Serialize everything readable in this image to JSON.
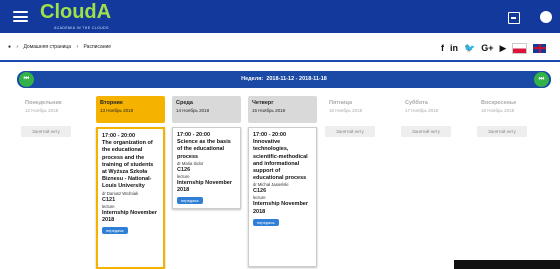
{
  "brand": {
    "name": "CloudA",
    "tagline": "ACADEMIA IN THE CLOUDS"
  },
  "breadcrumb": {
    "home": "Домашняя страница",
    "current": "Расписание"
  },
  "social": [
    "f",
    "in",
    "t",
    "G+",
    "yt"
  ],
  "week": {
    "label": "Неделя:",
    "range": "2018-11-12 - 2018-11-18"
  },
  "days": [
    {
      "name": "Понедельник",
      "date": "12 Ноябрь 2018",
      "busy": "Занятий нету"
    },
    {
      "name": "Вторник",
      "date": "13 Ноябрь 2018",
      "event": {
        "time": "17:00 - 20:00",
        "title": "The organization of the educational process and the training of students at Wyższa Szkoła Biznesu - National-Louis University",
        "teacher": "dr Dariusz Woźniak",
        "room": "C121",
        "type": "lecture",
        "course": "Internship November 2018",
        "action": "передача"
      }
    },
    {
      "name": "Среда",
      "date": "14 Ноябрь 2018",
      "event": {
        "time": "17:00 - 20:00",
        "title": "Science as the basis of the educational process",
        "teacher": "dr Maria Sidor",
        "room": "C126",
        "type": "lecture",
        "course": "Internship November 2018",
        "action": "передача"
      }
    },
    {
      "name": "Четверг",
      "date": "15 Ноябрь 2018",
      "event": {
        "time": "17:00 - 20:00",
        "title": "Innovative technologies, scientific-methodical and informational support of educational process",
        "teacher": "dr Michał Jasieński",
        "room": "C126",
        "type": "lecture",
        "course": "Internship November 2018",
        "action": "передача"
      }
    },
    {
      "name": "Пятница",
      "date": "16 Ноябрь 2018",
      "busy": "Занятий нету"
    },
    {
      "name": "Суббота",
      "date": "17 Ноябрь 2018",
      "busy": "Занятий нету"
    },
    {
      "name": "Воскресенье",
      "date": "18 Ноябрь 2018",
      "busy": "Занятий нету"
    }
  ],
  "colors": {
    "topbar": "#12399b",
    "brand": "#9fe04a",
    "today": "#f5b300",
    "nav": "#1a4aa6",
    "navButton": "#34b24a"
  }
}
